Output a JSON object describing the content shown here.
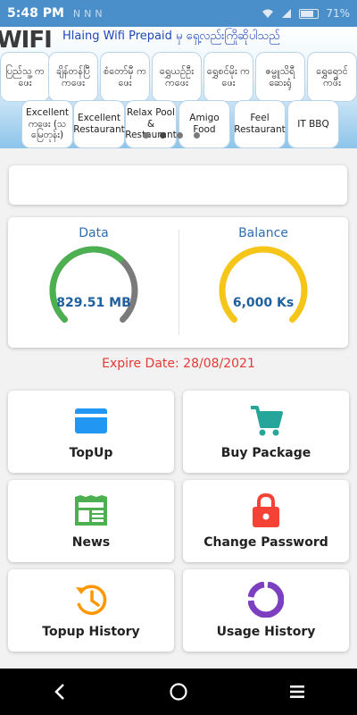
{
  "status_bar": {
    "time": "5:48 PM",
    "notif_icons": [
      "N",
      "N",
      "N"
    ],
    "battery": "71%"
  },
  "banner": {
    "logo": "WIFI",
    "marquee": "Hlaing Wifi Prepaid မှ ရှေ့လည်းကြိုဆိုပါသည်",
    "row1": [
      "ပြည်သူ့ ကဖေး",
      "ချိန်တန်ပြီ ကဖေး",
      "စံတော်မှီ ကဖေး",
      "ရွှေယဉ်ဦး ကဖေး",
      "ရွှေစင်မိုး ကဖေး",
      "ဇမ္ဗူသိရီ ဆေးရုံ",
      "ရွှေရောင် ကဖီး"
    ],
    "row2": [
      "Excellent ကဖေး (သမြေတုန်း)",
      "Excellent Restaurant",
      "Relax Pool & Restaurant",
      "Amigo Food",
      "Feel Restaurant",
      "IT BBQ"
    ],
    "slide_count": 4,
    "active_slide": 1
  },
  "search": {
    "value": ""
  },
  "data_gauge": {
    "title": "Data",
    "value": "829.51 MB",
    "remaining_fraction": 0.65,
    "color": "#4caf50",
    "track_color": "#7a7a7a"
  },
  "balance_gauge": {
    "title": "Balance",
    "value": "6,000 Ks",
    "remaining_fraction": 1.0,
    "color": "#f5c518",
    "track_color": "#e0e0e0"
  },
  "expire": "Expire Date: 28/08/2021",
  "tiles": {
    "topup": {
      "label": "TopUp",
      "icon": "credit-card-icon",
      "color": "#2196f3"
    },
    "buy_package": {
      "label": "Buy Package",
      "icon": "shopping-cart-icon",
      "color": "#26a69a"
    },
    "news": {
      "label": "News",
      "icon": "newspaper-icon",
      "color": "#4caf50"
    },
    "change_password": {
      "label": "Change Password",
      "icon": "lock-icon",
      "color": "#f44336"
    },
    "topup_history": {
      "label": "Topup History",
      "icon": "history-icon",
      "color": "#ff9800"
    },
    "usage_history": {
      "label": "Usage History",
      "icon": "donut-chart-icon",
      "color": "#7b3fbf"
    }
  },
  "nav": {
    "back": "back-icon",
    "home": "home-icon",
    "recents": "recents-icon"
  }
}
